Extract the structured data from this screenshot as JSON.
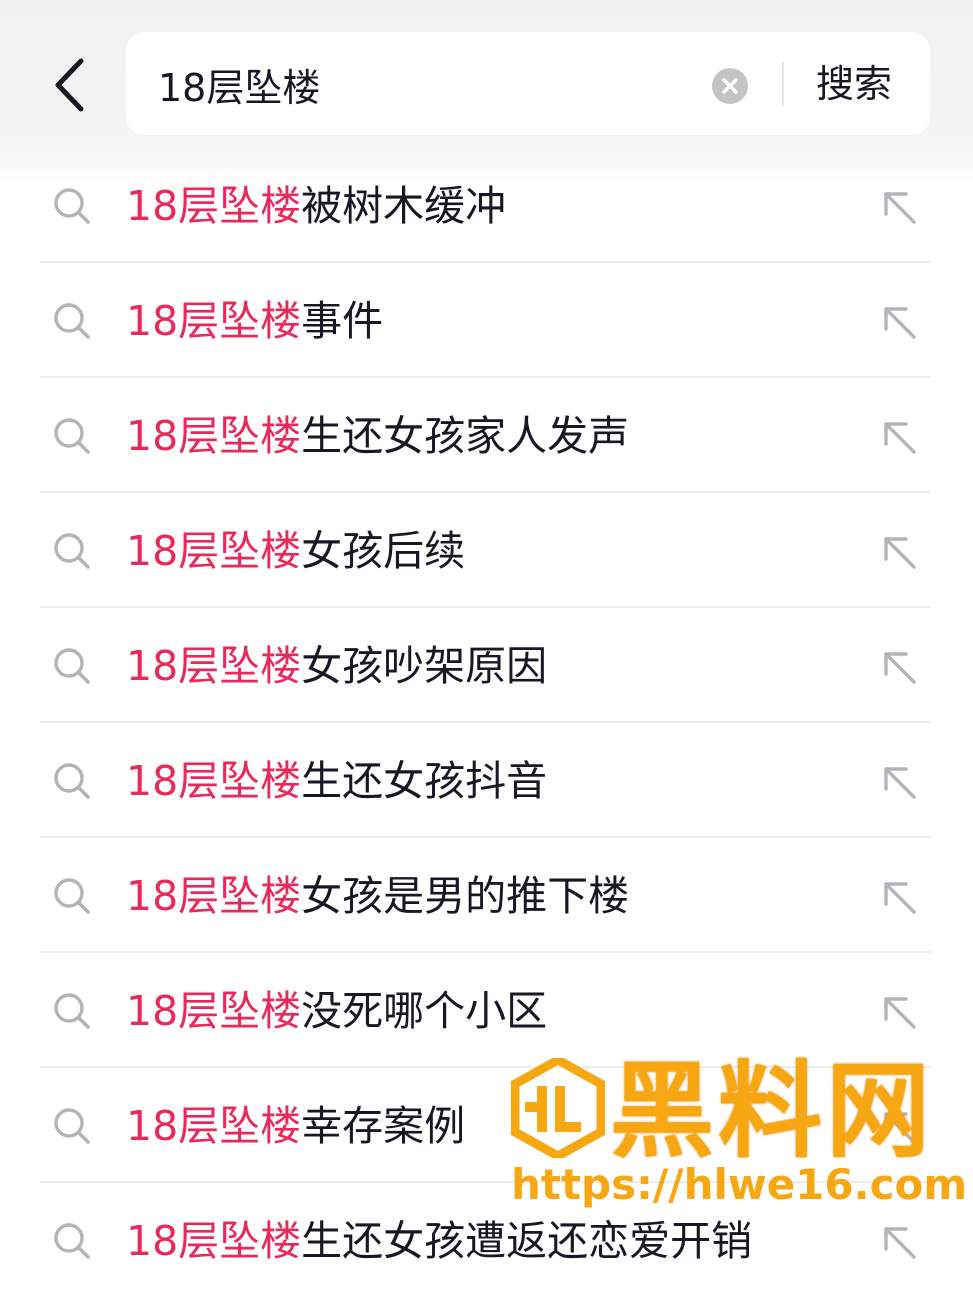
{
  "header": {
    "search_value": "18层坠楼",
    "search_button_label": "搜索"
  },
  "suggestions": [
    {
      "highlight": "18层坠楼",
      "rest": "被树木缓冲"
    },
    {
      "highlight": "18层坠楼",
      "rest": "事件"
    },
    {
      "highlight": "18层坠楼",
      "rest": "生还女孩家人发声"
    },
    {
      "highlight": "18层坠楼",
      "rest": "女孩后续"
    },
    {
      "highlight": "18层坠楼",
      "rest": "女孩吵架原因"
    },
    {
      "highlight": "18层坠楼",
      "rest": "生还女孩抖音"
    },
    {
      "highlight": "18层坠楼",
      "rest": "女孩是男的推下楼"
    },
    {
      "highlight": "18层坠楼",
      "rest": "没死哪个小区"
    },
    {
      "highlight": "18层坠楼",
      "rest": "幸存案例"
    },
    {
      "highlight": "18层坠楼",
      "rest": "生还女孩遭返还恋爱开销"
    }
  ],
  "watermark": {
    "title": "黑料网",
    "url": "https://hlwe16.com"
  },
  "colors": {
    "highlight": "#e8295a",
    "text": "#161823",
    "icon": "#b4b4b8",
    "watermark": "#f6a712"
  },
  "icons": {
    "back": "chevron-left-icon",
    "clear": "clear-circle-icon",
    "suggestion": "search-icon",
    "fill": "arrow-up-left-icon"
  }
}
